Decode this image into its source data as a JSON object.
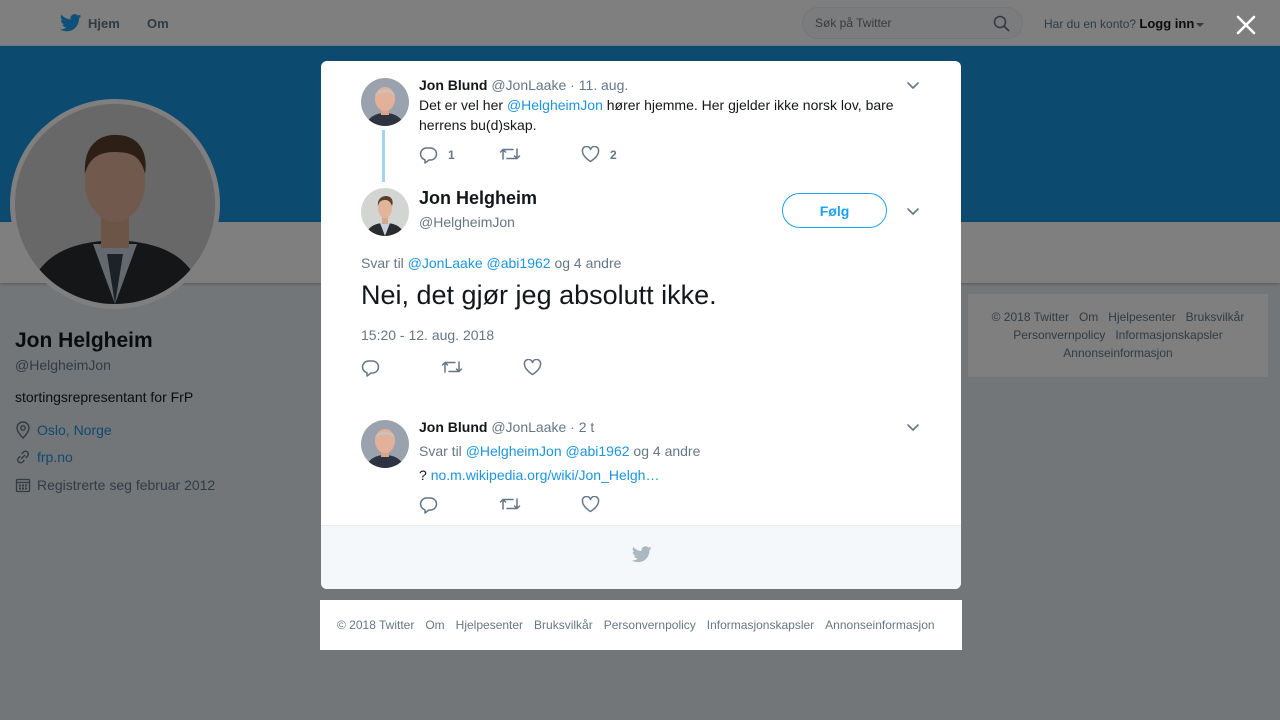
{
  "topbar": {
    "home": "Hjem",
    "about": "Om",
    "search_placeholder": "Søk på Twitter",
    "account_prompt": "Har du en konto?",
    "login": "Logg inn"
  },
  "profile": {
    "name": "Jon Helgheim",
    "handle": "@HelgheimJon",
    "bio": "stortingsrepresentant for FrP",
    "location": "Oslo, Norge",
    "url": "frp.no",
    "joined": "Registrerte seg februar 2012"
  },
  "side_footer": {
    "items": [
      "© 2018 Twitter",
      "Om",
      "Hjelpesenter",
      "Bruksvilkår",
      "Personvernpolicy",
      "Informasjonskapsler",
      "Annonseinformasjon"
    ]
  },
  "modal": {
    "parent_tweet": {
      "name": "Jon Blund",
      "handle": "@JonLaake",
      "time": "· 11. aug.",
      "text_before": "Det er vel her ",
      "mention": "@HelgheimJon",
      "text_after": " hører hjemme. Her gjelder ikke norsk lov, bare herrens bu(d)skap.",
      "reply_count": "1",
      "like_count": "2"
    },
    "main_tweet": {
      "name": "Jon Helgheim",
      "handle": "@HelgheimJon",
      "follow_label": "Følg",
      "reply_prefix": "Svar til ",
      "reply_mention_1": "@JonLaake",
      "reply_mention_2": "@abi1962",
      "reply_suffix": " og 4 andre",
      "text": "Nei, det gjør jeg absolutt ikke.",
      "timestamp": "15:20 - 12. aug. 2018"
    },
    "reply_tweet": {
      "name": "Jon Blund",
      "handle": "@JonLaake",
      "time": "· 2 t",
      "reply_prefix": "Svar til ",
      "reply_mention_1": "@HelgheimJon",
      "reply_mention_2": "@abi1962",
      "reply_suffix": " og 4 andre",
      "text_prefix": "? ",
      "link": "no.m.wikipedia.org/wiki/Jon_Helgh…"
    }
  },
  "page_footer": {
    "items": [
      "© 2018 Twitter",
      "Om",
      "Hjelpesenter",
      "Bruksvilkår",
      "Personvernpolicy",
      "Informasjonskapsler",
      "Annonseinformasjon"
    ]
  },
  "colors": {
    "brand_blue": "#1da1f2",
    "banner_blue": "#1b95e0",
    "thread_line": "#a5d3f2"
  },
  "icons": [
    "twitter-bird-icon",
    "search-icon",
    "close-icon",
    "location-pin-icon",
    "link-icon",
    "calendar-icon",
    "reply-icon",
    "retweet-icon",
    "like-icon",
    "chevron-down-icon"
  ]
}
